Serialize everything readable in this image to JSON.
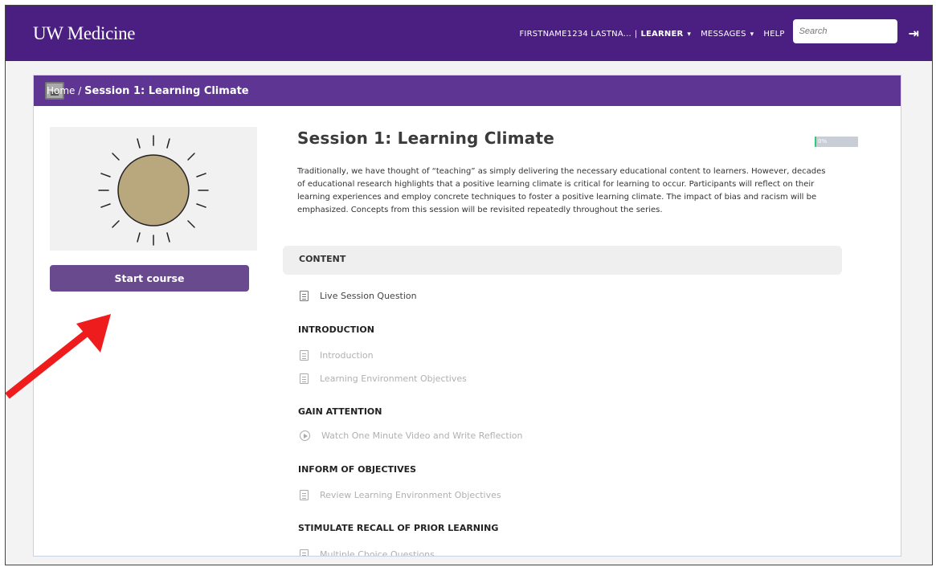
{
  "header": {
    "logo": "UW Medicine",
    "user": "FIRSTNAME1234 LASTNA...",
    "separator": "|",
    "role": "LEARNER",
    "messages": "MESSAGES",
    "help": "HELP",
    "search_placeholder": "Search",
    "logout_icon": "sign-out-icon",
    "caret": "▾"
  },
  "breadcrumb": {
    "home": "Home",
    "separator": "/",
    "current": "Session 1: Learning Climate"
  },
  "course": {
    "title": "Session 1: Learning Climate",
    "progress_label": "0%",
    "progress_value": 0.04,
    "description": "Traditionally, we have thought of “teaching” as simply delivering the necessary educational content to learners. However, decades of educational research highlights that a positive learning climate is critical for learning to occur. Participants will reflect on their learning experiences and employ concrete techniques to foster a positive learning climate. The impact of bias and racism will be emphasized. Concepts from this session will be revisited repeatedly throughout the series.",
    "start_button": "Start course",
    "thumbnail_icon": "sun-icon"
  },
  "content": {
    "header": "CONTENT",
    "first_item": "Live Session Question",
    "sections": [
      {
        "title": "INTRODUCTION",
        "items": [
          "Introduction",
          "Learning Environment Objectives"
        ]
      },
      {
        "title": "GAIN ATTENTION",
        "items": [
          "Watch One Minute Video and Write Reflection"
        ]
      },
      {
        "title": "INFORM OF OBJECTIVES",
        "items": [
          "Review Learning Environment Objectives"
        ]
      },
      {
        "title": "STIMULATE RECALL OF PRIOR LEARNING",
        "items": [
          "Multiple Choice Questions"
        ]
      }
    ]
  },
  "colors": {
    "header_bg": "#4b1f82",
    "breadcrumb_bg": "#5e3592",
    "button_bg": "#6a4a8e",
    "progress_fill": "#2ecc71",
    "arrow": "#ee1c1c",
    "sun_fill": "#b9a77d"
  }
}
